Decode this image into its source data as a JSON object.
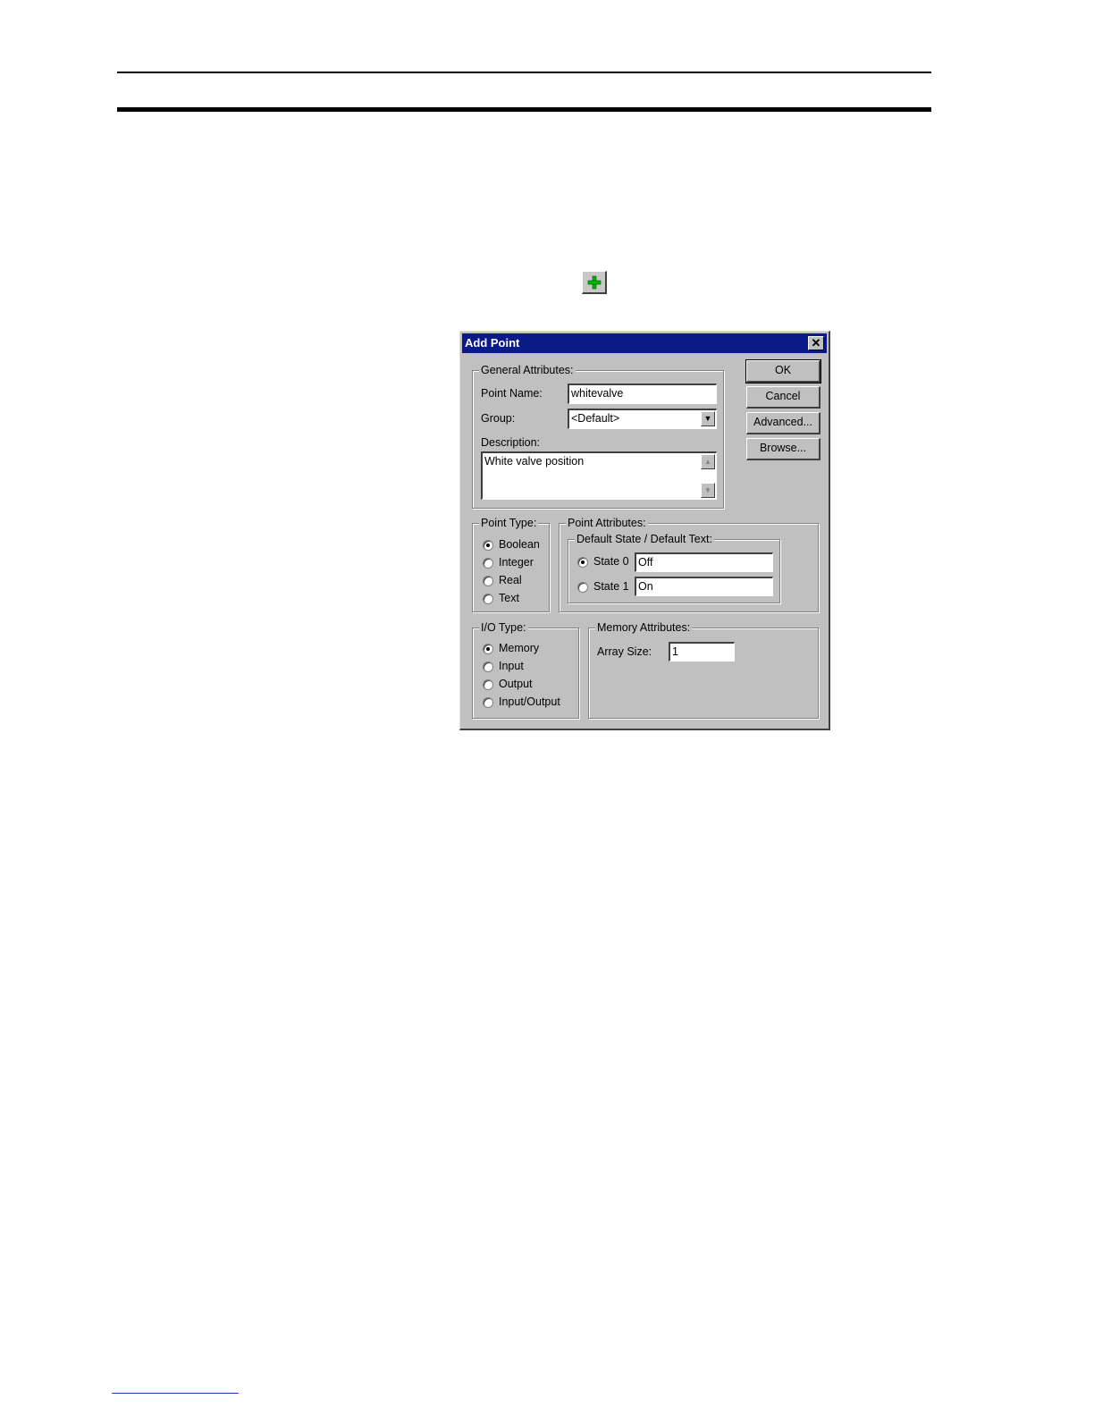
{
  "dialog": {
    "title": "Add Point",
    "buttons": {
      "ok": "OK",
      "cancel": "Cancel",
      "advanced": "Advanced...",
      "browse": "Browse..."
    },
    "general": {
      "legend": "General Attributes:",
      "point_name_label": "Point Name:",
      "point_name_value": "whitevalve",
      "group_label": "Group:",
      "group_value": "<Default>",
      "description_label": "Description:",
      "description_value": "White valve position"
    },
    "point_type": {
      "legend": "Point Type:",
      "options": [
        "Boolean",
        "Integer",
        "Real",
        "Text"
      ],
      "selected": "Boolean"
    },
    "point_attributes": {
      "legend": "Point Attributes:",
      "default_state_legend": "Default State / Default Text:",
      "state0_label": "State 0",
      "state0_value": "Off",
      "state1_label": "State 1",
      "state1_value": "On",
      "selected": "State 0"
    },
    "io_type": {
      "legend": "I/O Type:",
      "options": [
        "Memory",
        "Input",
        "Output",
        "Input/Output"
      ],
      "selected": "Memory"
    },
    "memory_attributes": {
      "legend": "Memory Attributes:",
      "array_size_label": "Array Size:",
      "array_size_value": "1"
    }
  }
}
